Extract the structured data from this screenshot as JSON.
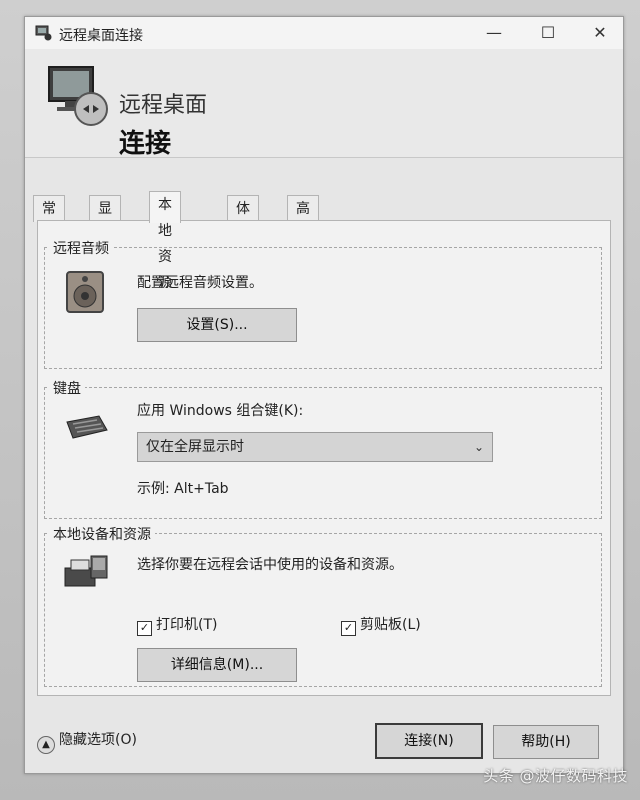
{
  "window": {
    "title": "远程桌面连接"
  },
  "banner": {
    "line1": "远程桌面",
    "line2": "连接"
  },
  "tabs": [
    "常规",
    "显示",
    "本地资源",
    "体验",
    "高级"
  ],
  "active_tab": "本地资源",
  "audio": {
    "legend": "远程音频",
    "description": "配置远程音频设置。",
    "settings_button": "设置(S)..."
  },
  "keyboard": {
    "legend": "键盘",
    "label": "应用 Windows 组合键(K):",
    "selected_option": "仅在全屏显示时",
    "example": "示例: Alt+Tab"
  },
  "devices": {
    "legend": "本地设备和资源",
    "description": "选择你要在远程会话中使用的设备和资源。",
    "printer_label": "打印机(T)",
    "printer_checked": true,
    "clipboard_label": "剪贴板(L)",
    "clipboard_checked": true,
    "details_button": "详细信息(M)..."
  },
  "footer": {
    "hide_options": "隐藏选项(O)",
    "connect_button": "连接(N)",
    "help_button": "帮助(H)"
  },
  "watermark": "头条 @波仔数码科技"
}
